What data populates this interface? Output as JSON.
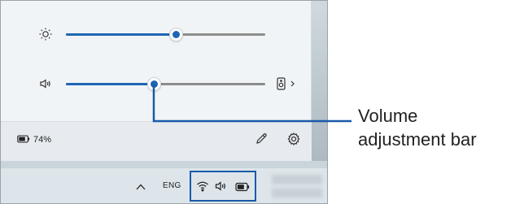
{
  "quick_settings": {
    "brightness": {
      "icon": "brightness-icon",
      "level": 0.55
    },
    "volume": {
      "icon": "speaker-icon",
      "level": 0.44,
      "output_icon": "audio-output-device-icon"
    },
    "battery": {
      "icon": "battery-icon",
      "percent_label": "74%"
    },
    "edit_icon": "pencil-icon",
    "settings_icon": "gear-icon"
  },
  "taskbar": {
    "chevron_icon": "chevron-up-icon",
    "language": "ENG",
    "tray": [
      "wifi-icon",
      "speaker-icon",
      "battery-icon"
    ]
  },
  "callout": {
    "line1": "Volume",
    "line2": "adjustment bar"
  },
  "colors": {
    "accent": "#1f66b4",
    "highlight_box": "#1a5aa8",
    "callout_line": "#1a5aa8"
  }
}
